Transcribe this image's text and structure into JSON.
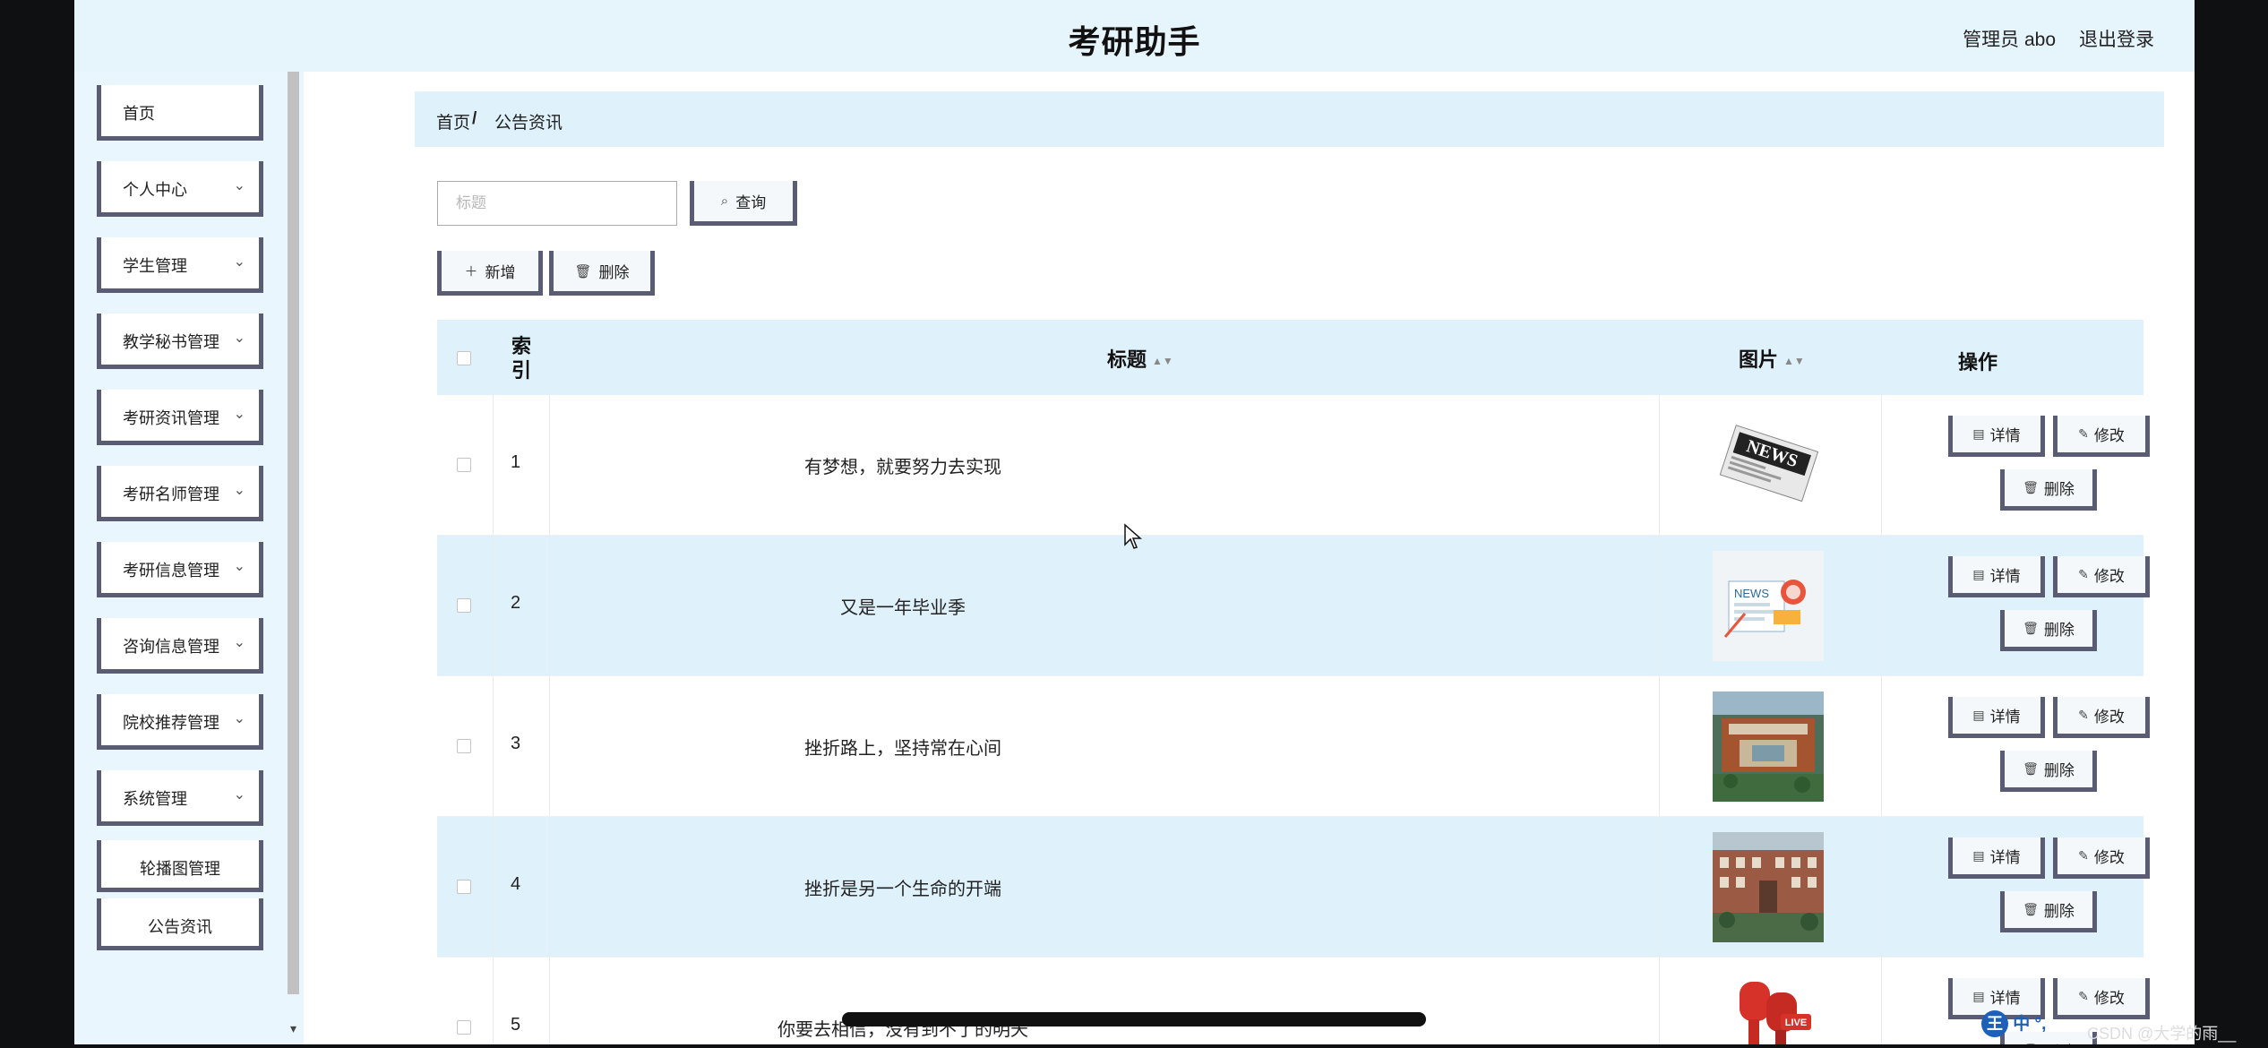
{
  "header": {
    "title": "考研助手",
    "user": "管理员 abo",
    "logout": "退出登录"
  },
  "sidebar": {
    "items": [
      {
        "label": "首页",
        "chevron": false
      },
      {
        "label": "个人中心",
        "chevron": true
      },
      {
        "label": "学生管理",
        "chevron": true
      },
      {
        "label": "教学秘书管理",
        "chevron": true
      },
      {
        "label": "考研资讯管理",
        "chevron": true
      },
      {
        "label": "考研名师管理",
        "chevron": true
      },
      {
        "label": "考研信息管理",
        "chevron": true
      },
      {
        "label": "咨询信息管理",
        "chevron": true
      },
      {
        "label": "院校推荐管理",
        "chevron": true
      },
      {
        "label": "系统管理",
        "chevron": true
      }
    ],
    "subitems": [
      {
        "label": "轮播图管理"
      },
      {
        "label": "公告资讯"
      }
    ]
  },
  "breadcrumb": {
    "home": "首页",
    "separator": "/",
    "current": "公告资讯"
  },
  "search": {
    "placeholder": "标题",
    "button": "查询"
  },
  "toolbar": {
    "add": "新增",
    "delete": "删除"
  },
  "table": {
    "columns": {
      "index": "索\n引",
      "title": "标题",
      "image": "图片",
      "actions": "操作"
    },
    "rows": [
      {
        "index": "1",
        "title": "有梦想，就要努力去实现",
        "image_icon": "newspaper-image"
      },
      {
        "index": "2",
        "title": "又是一年毕业季",
        "image_icon": "news-illustration-image"
      },
      {
        "index": "3",
        "title": "挫折路上，坚持常在心间",
        "image_icon": "campus-aerial-image"
      },
      {
        "index": "4",
        "title": "挫折是另一个生命的开端",
        "image_icon": "campus-building-image"
      },
      {
        "index": "5",
        "title": "你要去相信，没有到不了的明天",
        "image_icon": "live-microphone-image"
      }
    ],
    "actions": {
      "detail": "详情",
      "edit": "修改",
      "delete": "删除"
    }
  },
  "overlay": {
    "tray_text": "中 °,",
    "watermark": "CSDN @大学的雨__"
  },
  "colors": {
    "header_bg": "#e6f4fc",
    "sidebar_bg": "#eaf6fd",
    "row_alt_bg": "#dff1fb",
    "button_border": "#5a5c73"
  }
}
